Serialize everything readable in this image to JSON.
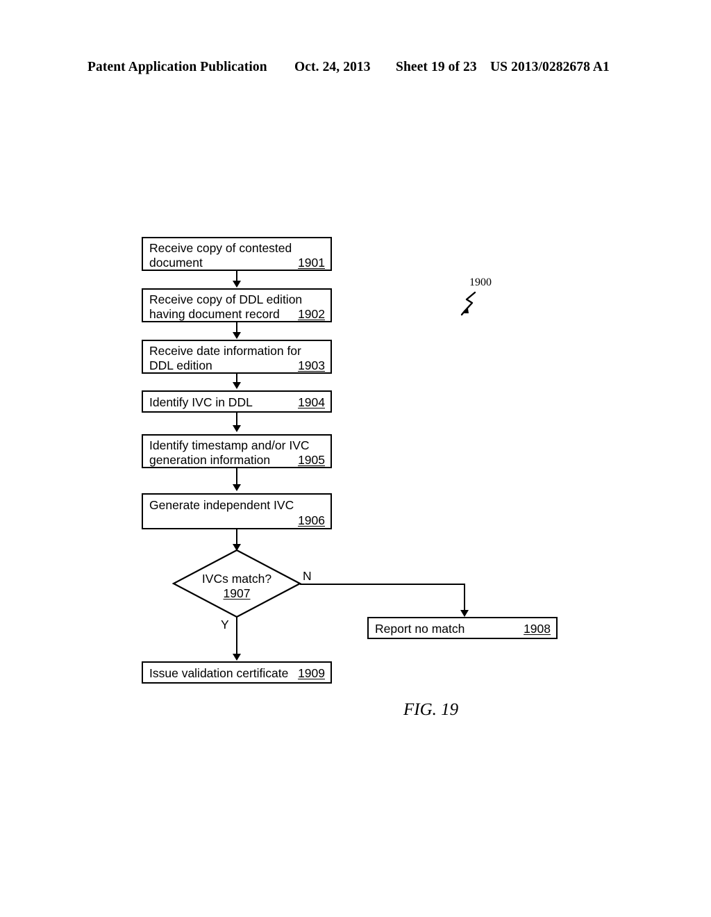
{
  "header": {
    "publication": "Patent Application Publication",
    "date": "Oct. 24, 2013",
    "sheet": "Sheet 19 of 23",
    "patent_number": "US 2013/0282678 A1"
  },
  "figure": {
    "caption": "FIG. 19",
    "diagram_reference": "1900"
  },
  "flowchart": {
    "type": "flowchart",
    "nodes": [
      {
        "id": "1901",
        "shape": "process",
        "lines": [
          "Receive copy of contested",
          "document"
        ],
        "ref": "1901",
        "ref_line": 1
      },
      {
        "id": "1902",
        "shape": "process",
        "lines": [
          "Receive copy of DDL edition",
          "having document record"
        ],
        "ref": "1902",
        "ref_line": 1
      },
      {
        "id": "1903",
        "shape": "process",
        "lines": [
          "Receive date information for",
          "DDL edition"
        ],
        "ref": "1903",
        "ref_line": 1
      },
      {
        "id": "1904",
        "shape": "process",
        "lines": [
          "Identify IVC in DDL"
        ],
        "ref": "1904",
        "ref_line": 0
      },
      {
        "id": "1905",
        "shape": "process",
        "lines": [
          "Identify timestamp and/or IVC",
          "generation information"
        ],
        "ref": "1905",
        "ref_line": 1
      },
      {
        "id": "1906",
        "shape": "process",
        "lines": [
          "Generate independent IVC",
          ""
        ],
        "ref": "1906",
        "ref_line": 1
      },
      {
        "id": "1907",
        "shape": "decision",
        "lines": [
          "IVCs match?"
        ],
        "ref": "1907"
      },
      {
        "id": "1908",
        "shape": "process",
        "lines": [
          "Report no match"
        ],
        "ref": "1908",
        "ref_line": 0
      },
      {
        "id": "1909",
        "shape": "process",
        "lines": [
          "Issue validation certificate"
        ],
        "ref": "1909",
        "ref_line": 0
      }
    ],
    "branch_labels": {
      "no": "N",
      "yes": "Y"
    }
  }
}
